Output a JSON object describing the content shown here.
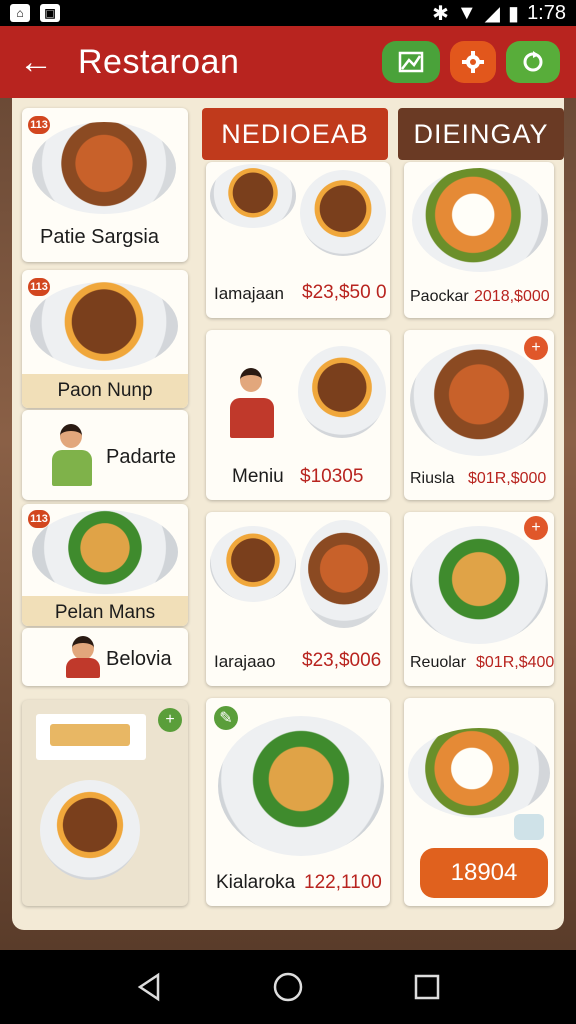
{
  "status_bar": {
    "time": "1:78"
  },
  "app_bar": {
    "title": "Restaroan",
    "actions": [
      "map-icon",
      "settings-icon",
      "refresh-icon"
    ]
  },
  "tabs": [
    {
      "label": "NEDIOEAB",
      "active": true
    },
    {
      "label": "DIEINGAY",
      "active": false
    }
  ],
  "left_column": {
    "items": [
      {
        "badge": "113",
        "label": "Patie Sargsia"
      },
      {
        "badge": "113",
        "label": "Paon Nunp"
      },
      {
        "label": "Padarte"
      },
      {
        "badge": "113",
        "label": "Pelan Mans"
      },
      {
        "label": "Belovia"
      }
    ]
  },
  "grid": {
    "rows": [
      {
        "left": {
          "name": "Iamajaan",
          "price": "$23,$50 0"
        },
        "right": {
          "name": "Paockar",
          "price": "2018,$000"
        }
      },
      {
        "left": {
          "name": "Meniu",
          "price": "$10305"
        },
        "right": {
          "name": "Riusla",
          "price": "$01R,$000"
        }
      },
      {
        "left": {
          "name": "Iarajaao",
          "price": "$23,$006"
        },
        "right": {
          "name": "Reuolar",
          "price": "$01R,$400"
        }
      },
      {
        "left": {
          "name": "Kialaroka",
          "price": "122,1100"
        }
      }
    ]
  },
  "order_button": {
    "label": "18904"
  },
  "colors": {
    "primary": "#b8241f",
    "accent_orange": "#e0611e",
    "accent_green": "#4aa23a",
    "panel": "#f3ead6"
  }
}
